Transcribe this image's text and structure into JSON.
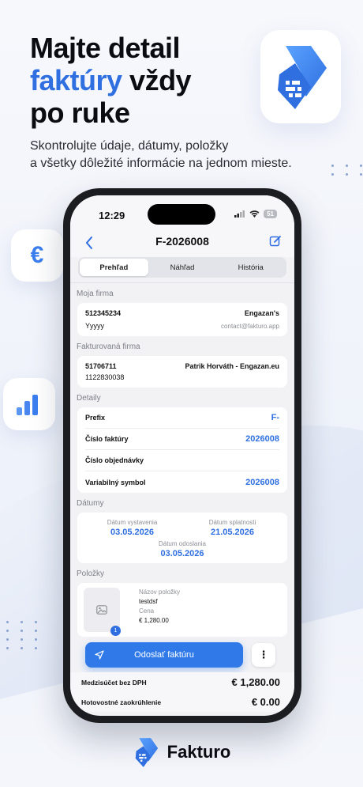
{
  "hero": {
    "line1": "Majte detail",
    "line2_accent": "faktúry",
    "line2_rest": " vždy",
    "line3": "po ruke",
    "subtitle_line1": "Skontrolujte údaje, dátumy, položky",
    "subtitle_line2": "a všetky dôležité informácie na jednom mieste."
  },
  "float_icons": {
    "euro": "€",
    "chart": "chart-icon",
    "logo": "fakturo-logo-icon"
  },
  "status_bar": {
    "time": "12:29",
    "battery": "51"
  },
  "nav": {
    "title": "F-2026008"
  },
  "tabs": [
    {
      "label": "Prehľad",
      "active": true
    },
    {
      "label": "Náhľad",
      "active": false
    },
    {
      "label": "História",
      "active": false
    }
  ],
  "my_company": {
    "section": "Moja firma",
    "id": "512345234",
    "name": "Engazan's",
    "sub": "Yyyyy",
    "email": "contact@fakturo.app"
  },
  "billed_company": {
    "section": "Fakturovaná firma",
    "id": "51706711",
    "name": "Patrik Horváth - Engazan.eu",
    "sub": "1122830038"
  },
  "details": {
    "section": "Detaily",
    "rows": [
      {
        "label": "Prefix",
        "value": "F-"
      },
      {
        "label": "Číslo faktúry",
        "value": "2026008"
      },
      {
        "label": "Číslo objednávky",
        "value": ""
      },
      {
        "label": "Variabilný symbol",
        "value": "2026008"
      }
    ]
  },
  "dates": {
    "section": "Dátumy",
    "issued_label": "Dátum vystavenia",
    "issued": "03.05.2026",
    "due_label": "Dátum splatnosti",
    "due": "21.05.2026",
    "sent_label": "Dátum odoslania",
    "sent": "03.05.2026"
  },
  "items": {
    "section": "Položky",
    "count_badge": "1",
    "name_label": "Názov položky",
    "name": "testdsf",
    "price_label": "Cena",
    "price": "€ 1,280.00"
  },
  "actions": {
    "send_label": "Odoslať faktúru",
    "more_label": "⋮"
  },
  "totals": [
    {
      "label": "Medzisúčet bez DPH",
      "value": "€ 1,280.00"
    },
    {
      "label": "Hotovostné zaokrúhlenie",
      "value": "€ 0.00"
    }
  ],
  "brand": {
    "name": "Fakturo"
  },
  "colors": {
    "accent": "#2f6fe0",
    "button": "#2f7ae8",
    "text": "#0b0b12"
  }
}
